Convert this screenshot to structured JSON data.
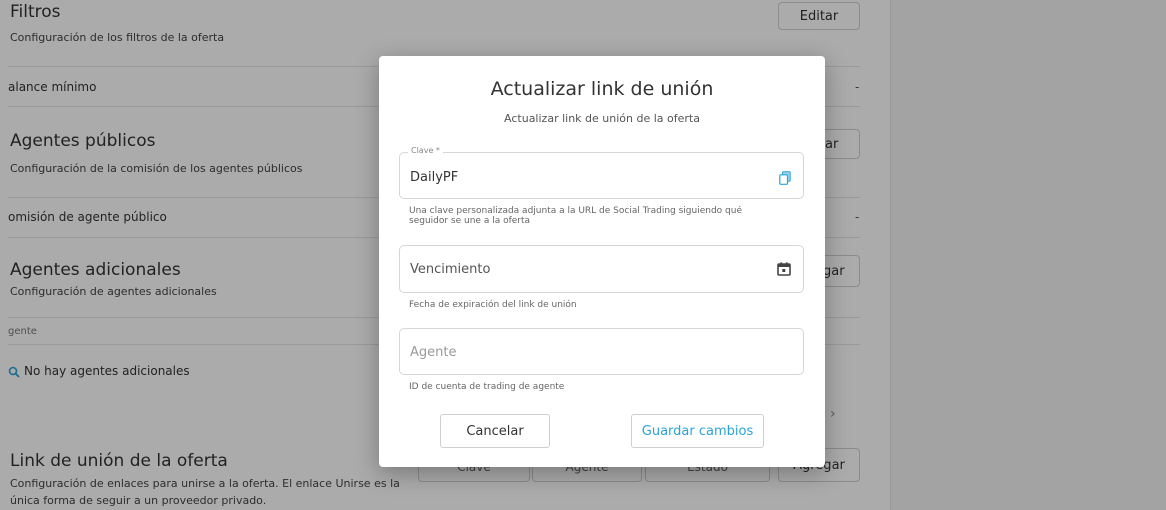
{
  "background": {
    "filters": {
      "title": "Filtros",
      "description": "Configuración de los filtros de la oferta",
      "edit_label": "Editar",
      "row_label": "alance mínimo",
      "row_value": "-"
    },
    "public_agents": {
      "title": "Agentes públicos",
      "description": "Configuración de la comisión de los agentes públicos",
      "button_label": "ar",
      "row_label": "omisión de agente público",
      "row_value": "-"
    },
    "additional_agents": {
      "title": "Agentes adicionales",
      "description": "Configuración de agentes adicionales",
      "button_label": "gar",
      "column_header": "gente",
      "empty_text": "No hay agentes adicionales"
    },
    "join_link": {
      "title": "Link de unión de la oferta",
      "description_line1": "Configuración de enlaces para unirse a la oferta. El enlace Unirse es la",
      "description_line2": "única forma de seguir a un proveedor privado.",
      "button_label": "Agregar",
      "partial_col1": "Clave",
      "partial_col2": "Agente",
      "partial_col3": "Estado"
    },
    "pagination_next": "›"
  },
  "modal": {
    "title": "Actualizar link de unión",
    "subtitle": "Actualizar link de unión de la oferta",
    "key_field": {
      "legend": "Clave *",
      "value": "DailyPF",
      "helper": "Una clave personalizada adjunta a la URL de Social Trading siguiendo qué seguidor se une a la oferta",
      "icon": "copy-icon"
    },
    "expiry_field": {
      "placeholder": "Vencimiento",
      "helper": "Fecha de expiración del link de unión",
      "icon": "calendar-icon"
    },
    "agent_field": {
      "placeholder": "Agente",
      "helper": "ID de cuenta de trading de agente"
    },
    "cancel_label": "Cancelar",
    "save_label": "Guardar cambios"
  },
  "colors": {
    "accent": "#2aa3d8",
    "overlay": "rgba(0,0,0,0.33)",
    "placeholder_muted": "#9a9a9a"
  }
}
